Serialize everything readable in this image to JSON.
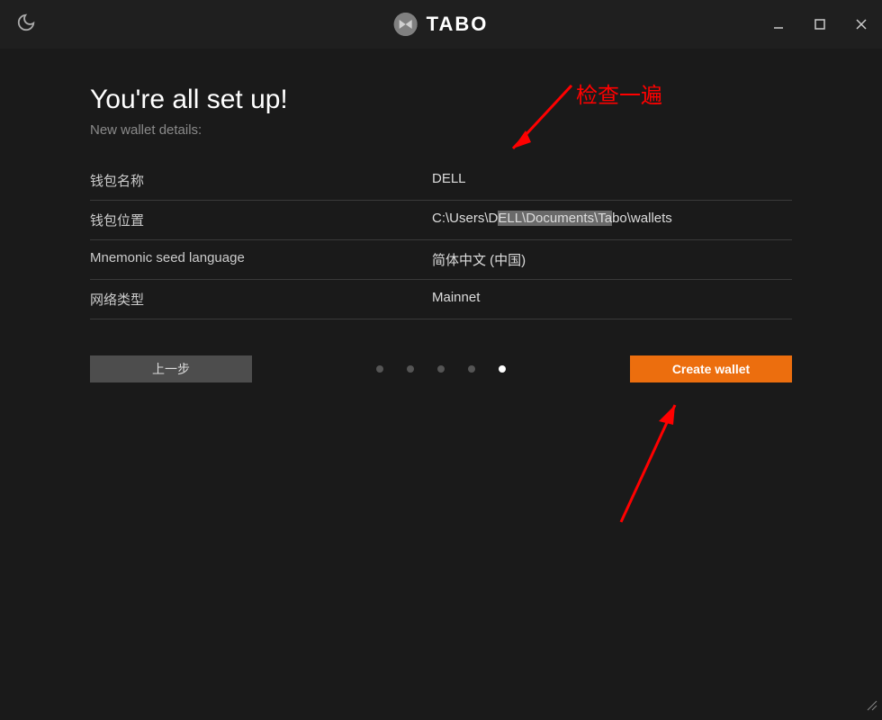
{
  "app": {
    "name": "TABO"
  },
  "heading": "You're all set up!",
  "subheading": "New wallet details:",
  "details": {
    "name_label": "钱包名称",
    "name_value": "DELL",
    "location_label": "钱包位置",
    "location_value_pre": "C:\\Users\\D",
    "location_value_highlight": "ELL\\Documents\\Ta",
    "location_value_post": "bo\\wallets",
    "seed_label": "Mnemonic seed language",
    "seed_value": "简体中文 (中国)",
    "network_label": "网络类型",
    "network_value": "Mainnet"
  },
  "buttons": {
    "previous": "上一步",
    "create": "Create wallet"
  },
  "annotation": {
    "text": "检查一遍"
  },
  "pagination": {
    "total": 5,
    "active_index": 4
  }
}
